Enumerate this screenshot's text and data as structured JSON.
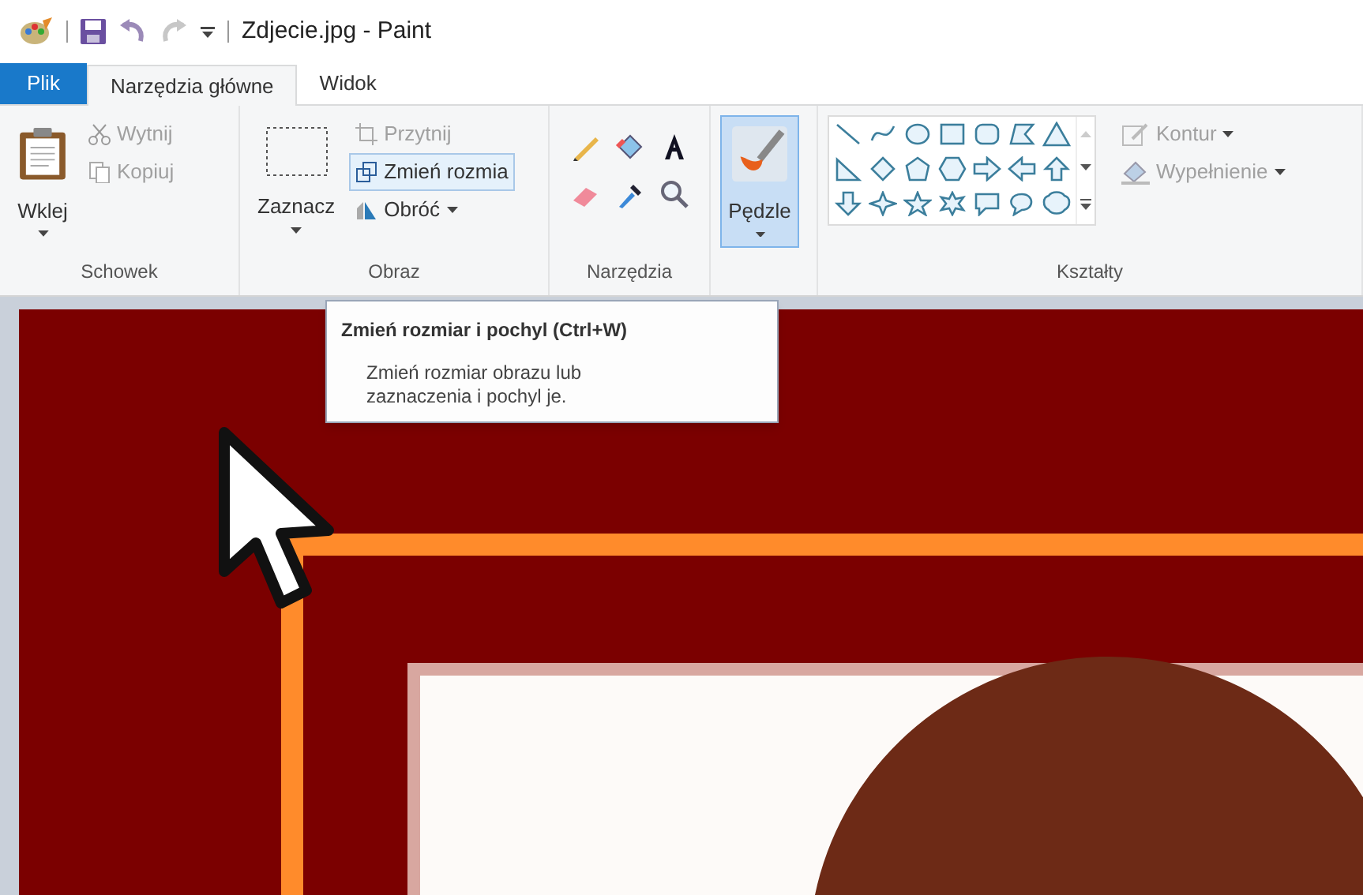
{
  "window": {
    "title": "Zdjecie.jpg - Paint"
  },
  "tabs": [
    {
      "label": "Plik",
      "kind": "file",
      "selected": false
    },
    {
      "label": "Narzędzia główne",
      "kind": "tab",
      "selected": true
    },
    {
      "label": "Widok",
      "kind": "tab",
      "selected": false
    }
  ],
  "groups": [
    {
      "label": "Schowek",
      "kind": "buttons",
      "large": {
        "label": "Wklej",
        "dropdown": true,
        "selected": false
      },
      "small": [
        {
          "label": "Wytnij",
          "disabled": true,
          "hovered": false,
          "dropdown": false
        },
        {
          "label": "Kopiuj",
          "disabled": true,
          "hovered": false,
          "dropdown": false
        }
      ]
    },
    {
      "label": "Obraz",
      "kind": "buttons",
      "large": {
        "label": "Zaznacz",
        "dropdown": true,
        "selected": false
      },
      "small": [
        {
          "label": "Przytnij",
          "disabled": true,
          "hovered": false,
          "dropdown": false
        },
        {
          "label": "Zmień rozmia",
          "disabled": false,
          "hovered": true,
          "dropdown": false
        },
        {
          "label": "Obróć",
          "disabled": false,
          "hovered": false,
          "dropdown": true
        }
      ]
    },
    {
      "label": "Narzędzia",
      "kind": "tools"
    },
    {
      "kind": "buttons",
      "large": {
        "label": "Pędzle",
        "dropdown": true,
        "selected": true
      }
    },
    {
      "label": "Kształty",
      "kind": "shapes",
      "small": [
        {
          "label": "Kontur",
          "disabled": true,
          "hovered": false,
          "dropdown": true
        },
        {
          "label": "Wypełnienie",
          "disabled": true,
          "hovered": false,
          "dropdown": true
        }
      ]
    }
  ],
  "tooltip": {
    "title": "Zmień rozmiar i pochyl (Ctrl+W)",
    "body": "Zmień rozmiar obrazu lub zaznaczenia i pochyl je."
  }
}
